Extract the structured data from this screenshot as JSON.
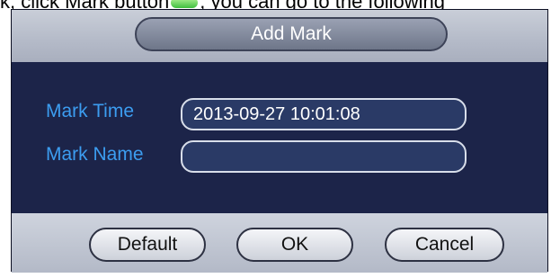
{
  "doc_text": {
    "before": "k, click Mark button",
    "after": ", you can go to the following"
  },
  "dialog": {
    "title": "Add Mark",
    "mark_time_label": "Mark Time",
    "mark_time_value": "2013-09-27 10:01:08",
    "mark_name_label": "Mark Name",
    "mark_name_value": ""
  },
  "buttons": {
    "default": "Default",
    "ok": "OK",
    "cancel": "Cancel"
  }
}
